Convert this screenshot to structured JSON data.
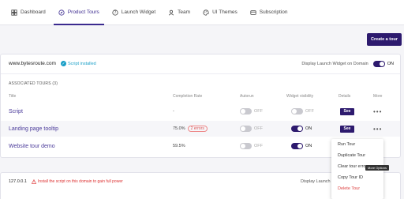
{
  "nav": {
    "tabs": [
      {
        "label": "Dashboard",
        "icon": "dashboard-icon"
      },
      {
        "label": "Product Tours",
        "icon": "compass-icon"
      },
      {
        "label": "Launch Widget",
        "icon": "help-circle-icon"
      },
      {
        "label": "Team",
        "icon": "team-icon"
      },
      {
        "label": "UI Themes",
        "icon": "palette-icon"
      },
      {
        "label": "Subscription",
        "icon": "card-icon"
      }
    ],
    "active_index": 1
  },
  "create_button": "Create a tour",
  "site1": {
    "domain": "www.bytesroute.com",
    "installed_label": "Script installed",
    "display_widget_label": "Display Launch Widget on Domain",
    "display_widget_state": "ON",
    "associated_label": "ASSOCIATED TOURS (3)",
    "columns": {
      "title": "Title",
      "completion": "Completion Rate",
      "autorun": "Autorun",
      "widget": "Widget visibility",
      "details": "Details",
      "more": "More"
    },
    "tours": [
      {
        "title": "Script",
        "completion": "-",
        "errors": "",
        "autorun": "OFF",
        "widget": "OFF",
        "details": "See",
        "more": "•••"
      },
      {
        "title": "Landing page tooltip",
        "completion": "75.0%",
        "errors": "2 errors",
        "autorun": "OFF",
        "widget": "ON",
        "details": "See",
        "more": "•••"
      },
      {
        "title": "Website tour demo",
        "completion": "59.5%",
        "errors": "",
        "autorun": "OFF",
        "widget": "ON",
        "details": "",
        "more": ""
      }
    ]
  },
  "menu": {
    "items": [
      "Run Tour",
      "Duplicate Tour",
      "Clear tour errors",
      "Copy Tour ID",
      "Delete Tour"
    ],
    "tooltip": "More Options"
  },
  "site2": {
    "domain": "127.0.0.1",
    "warning": "Install the script on this domain to gain full power",
    "display_widget_label": "Display Launch"
  },
  "colors": {
    "accent": "#2d1a6e",
    "link": "#4a3a9a",
    "installed": "#1a9fc7",
    "error": "#d33"
  }
}
